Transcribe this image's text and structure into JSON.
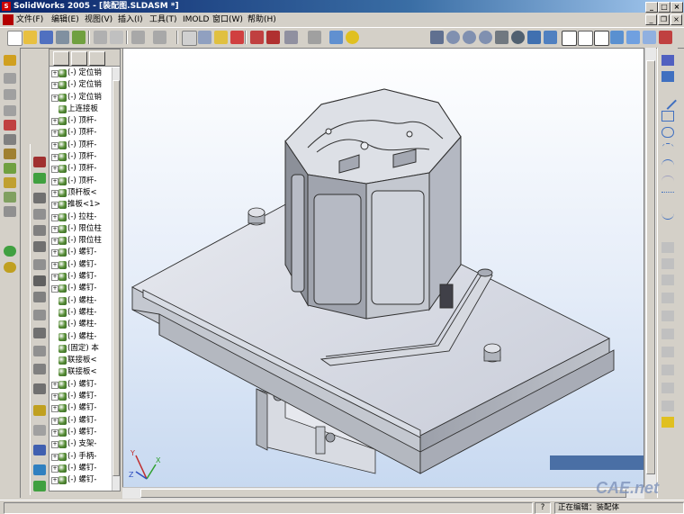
{
  "window": {
    "title": "SolidWorks 2005 - [装配图.SLDASM *]",
    "minimize": "_",
    "maximize": "□",
    "close": "×"
  },
  "menu": {
    "items": [
      "文件(F)",
      "编辑(E)",
      "视图(V)",
      "插入(I)",
      "工具(T)",
      "IMOLD",
      "窗口(W)",
      "帮助(H)"
    ],
    "doc_minimize": "_",
    "doc_restore": "❐",
    "doc_close": "×"
  },
  "tree": {
    "rows": [
      {
        "label": "(-) 定位销",
        "expanded": true
      },
      {
        "label": "(-) 定位销",
        "expanded": true
      },
      {
        "label": "(-) 定位销",
        "expanded": true
      },
      {
        "label": "上连接板",
        "expanded": false
      },
      {
        "label": "(-) 顶杆-",
        "expanded": true
      },
      {
        "label": "(-) 顶杆-",
        "expanded": true
      },
      {
        "label": "(-) 顶杆-",
        "expanded": true
      },
      {
        "label": "(-) 顶杆-",
        "expanded": true
      },
      {
        "label": "(-) 顶杆-",
        "expanded": true
      },
      {
        "label": "(-) 顶杆-",
        "expanded": true
      },
      {
        "label": "顶杆板<",
        "expanded": true
      },
      {
        "label": "推板<1>",
        "expanded": true
      },
      {
        "label": "(-) 拉柱-",
        "expanded": true
      },
      {
        "label": "(-) 限位柱",
        "expanded": true
      },
      {
        "label": "(-) 限位柱",
        "expanded": true
      },
      {
        "label": "(-) 螺钉-",
        "expanded": true
      },
      {
        "label": "(-) 螺钉-",
        "expanded": true
      },
      {
        "label": "(-) 螺钉-",
        "expanded": true
      },
      {
        "label": "(-) 螺钉-",
        "expanded": true
      },
      {
        "label": "(-) 螺柱-",
        "expanded": false
      },
      {
        "label": "(-) 螺柱-",
        "expanded": false
      },
      {
        "label": "(-) 螺柱-",
        "expanded": false
      },
      {
        "label": "(-) 螺柱-",
        "expanded": false
      },
      {
        "label": "(固定) 本",
        "expanded": false
      },
      {
        "label": "联接板<",
        "expanded": false
      },
      {
        "label": "联接板<",
        "expanded": false
      },
      {
        "label": "(-) 螺钉-",
        "expanded": true
      },
      {
        "label": "(-) 螺钉-",
        "expanded": true
      },
      {
        "label": "(-) 螺钉-",
        "expanded": true
      },
      {
        "label": "(-) 螺钉-",
        "expanded": true
      },
      {
        "label": "(-) 螺钉-",
        "expanded": true
      },
      {
        "label": "(-) 支架-",
        "expanded": true
      },
      {
        "label": "(-) 手柄-",
        "expanded": true
      },
      {
        "label": "(-) 螺钉-",
        "expanded": true
      },
      {
        "label": "(-) 螺钉-",
        "expanded": true
      }
    ]
  },
  "status": {
    "editing": "正在编辑：装配体",
    "help": "?"
  },
  "watermark": "CAE.net",
  "colors": {
    "title_start": "#0a246a",
    "model_fill": "#d4d8e0",
    "model_edge": "#303030",
    "status_box": "#4a6fa5"
  }
}
